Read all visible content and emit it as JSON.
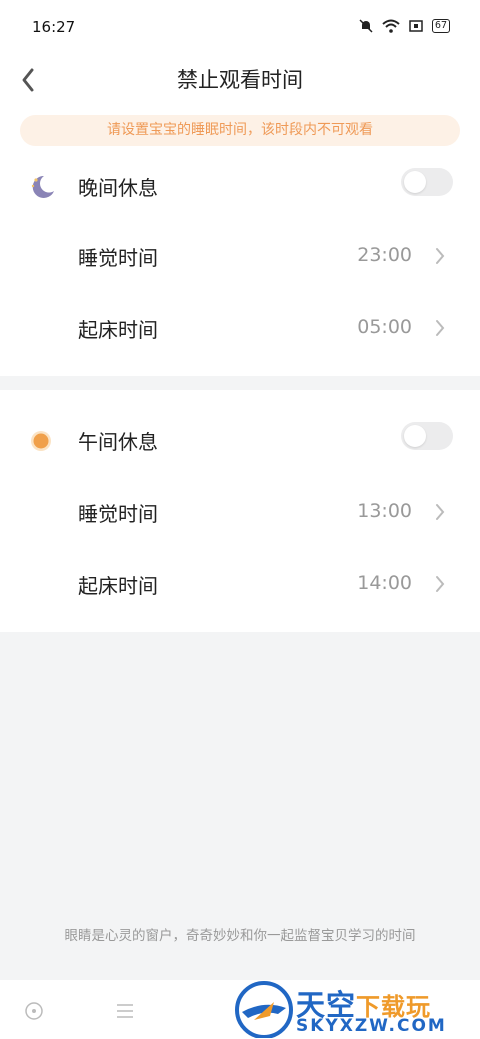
{
  "status_bar": {
    "time": "16:27",
    "battery": "67"
  },
  "header": {
    "title": "禁止观看时间"
  },
  "notice": {
    "text": "请设置宝宝的睡眠时间，该时段内不可观看"
  },
  "sections": [
    {
      "title": "晚间休息",
      "icon": "moon-icon",
      "enabled": false,
      "rows": [
        {
          "label": "睡觉时间",
          "value": "23:00"
        },
        {
          "label": "起床时间",
          "value": "05:00"
        }
      ]
    },
    {
      "title": "午间休息",
      "icon": "sun-icon",
      "enabled": false,
      "rows": [
        {
          "label": "睡觉时间",
          "value": "13:00"
        },
        {
          "label": "起床时间",
          "value": "14:00"
        }
      ]
    }
  ],
  "footer": {
    "text": "眼睛是心灵的窗户，奇奇妙妙和你一起监督宝贝学习的时间"
  },
  "watermark": {
    "cn_main": "天空",
    "cn_accent": "下载玩",
    "en": "SKYXZW.COM"
  },
  "colors": {
    "accent": "#ef9a57",
    "notice_bg": "#fdf1e6",
    "sun": "#f0a04b",
    "moon": "#8a84b6"
  }
}
